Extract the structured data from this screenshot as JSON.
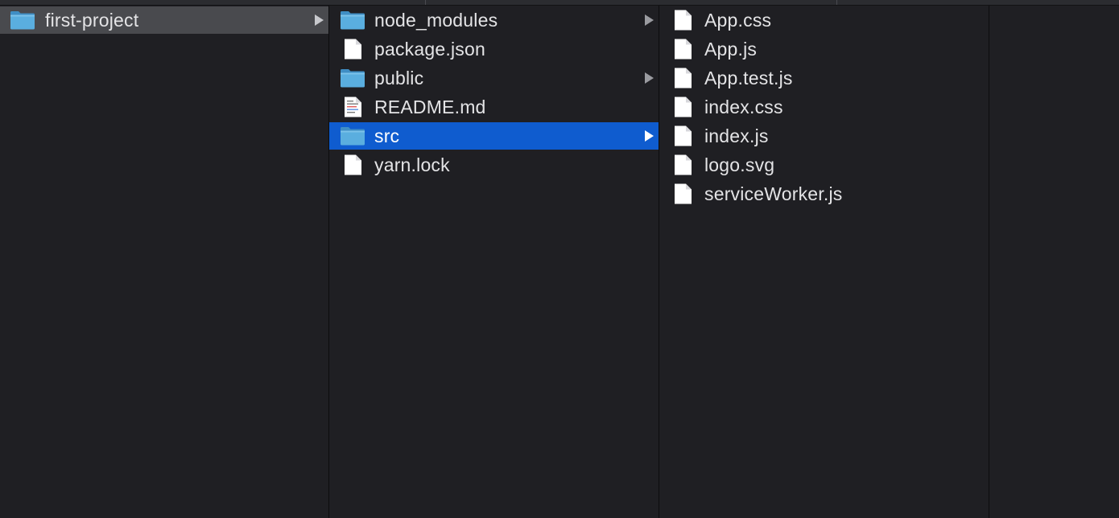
{
  "colors": {
    "background": "#1f1f23",
    "selection_active": "#0f5ccf",
    "selection_inactive": "#494a4e",
    "folder_blue": "#5aaedf",
    "text": "#e4e4e6"
  },
  "columns": [
    {
      "items": [
        {
          "name": "first-project",
          "kind": "folder",
          "icon": "folder-icon",
          "has_children": true,
          "state": "selected-inactive"
        }
      ]
    },
    {
      "items": [
        {
          "name": "node_modules",
          "kind": "folder",
          "icon": "folder-icon",
          "has_children": true,
          "state": "none"
        },
        {
          "name": "package.json",
          "kind": "file",
          "icon": "document-icon",
          "has_children": false,
          "state": "none"
        },
        {
          "name": "public",
          "kind": "folder",
          "icon": "folder-icon",
          "has_children": true,
          "state": "none"
        },
        {
          "name": "README.md",
          "kind": "text-file",
          "icon": "text-document-icon",
          "has_children": false,
          "state": "none"
        },
        {
          "name": "src",
          "kind": "folder",
          "icon": "folder-icon",
          "has_children": true,
          "state": "selected-active"
        },
        {
          "name": "yarn.lock",
          "kind": "file",
          "icon": "document-icon",
          "has_children": false,
          "state": "none"
        }
      ]
    },
    {
      "items": [
        {
          "name": "App.css",
          "kind": "file",
          "icon": "document-icon",
          "has_children": false,
          "state": "none"
        },
        {
          "name": "App.js",
          "kind": "file",
          "icon": "document-icon",
          "has_children": false,
          "state": "none"
        },
        {
          "name": "App.test.js",
          "kind": "file",
          "icon": "document-icon",
          "has_children": false,
          "state": "none"
        },
        {
          "name": "index.css",
          "kind": "file",
          "icon": "document-icon",
          "has_children": false,
          "state": "none"
        },
        {
          "name": "index.js",
          "kind": "file",
          "icon": "document-icon",
          "has_children": false,
          "state": "none"
        },
        {
          "name": "logo.svg",
          "kind": "file",
          "icon": "document-icon",
          "has_children": false,
          "state": "none"
        },
        {
          "name": "serviceWorker.js",
          "kind": "file",
          "icon": "document-icon",
          "has_children": false,
          "state": "none"
        }
      ]
    },
    {
      "items": []
    }
  ]
}
